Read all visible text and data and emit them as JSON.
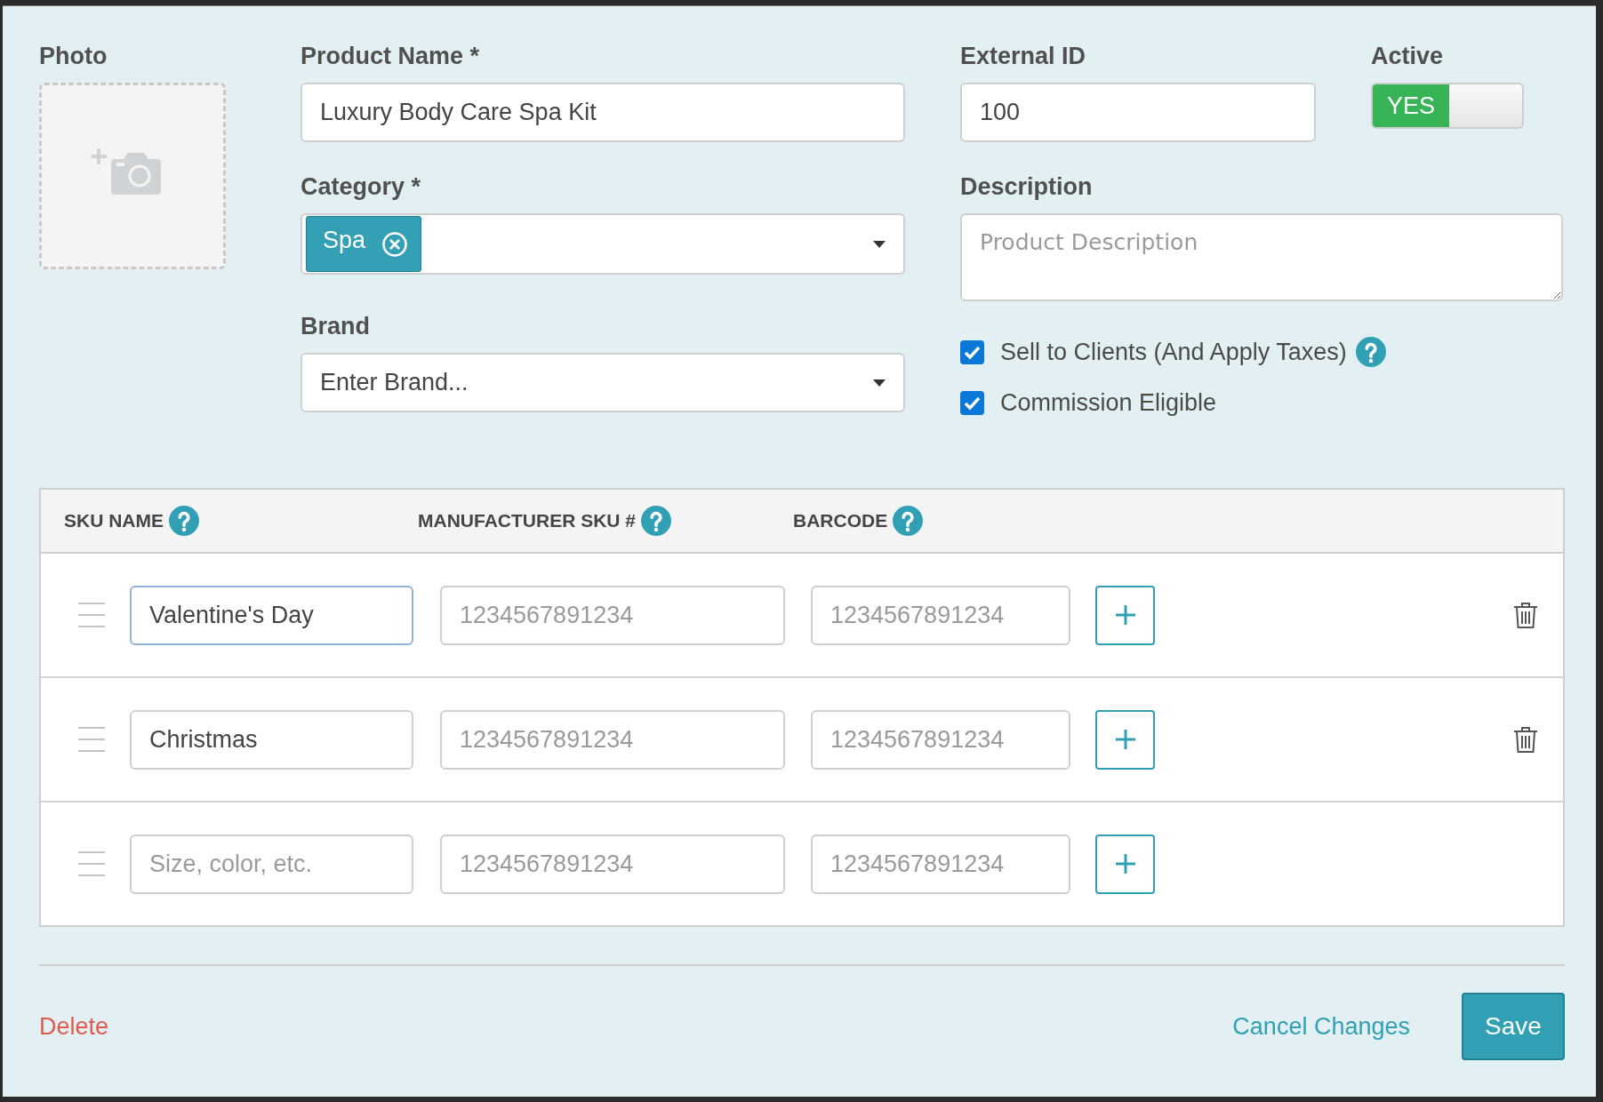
{
  "photo": {
    "label": "Photo"
  },
  "product_name": {
    "label": "Product Name *",
    "value": "Luxury Body Care Spa Kit"
  },
  "external_id": {
    "label": "External ID",
    "value": "100"
  },
  "active": {
    "label": "Active",
    "on": true,
    "on_label": "YES"
  },
  "category": {
    "label": "Category *",
    "tags": [
      {
        "label": "Spa"
      }
    ]
  },
  "description": {
    "label": "Description",
    "placeholder": "Product Description"
  },
  "brand": {
    "label": "Brand",
    "placeholder": "Enter Brand..."
  },
  "options": [
    {
      "label": "Sell to Clients (And Apply Taxes)",
      "checked": true,
      "help": true
    },
    {
      "label": "Commission Eligible",
      "checked": true,
      "help": false
    }
  ],
  "sku_table": {
    "columns": [
      {
        "label": "SKU NAME",
        "help": true
      },
      {
        "label": "MANUFACTURER SKU #",
        "help": true
      },
      {
        "label": "BARCODE",
        "help": true
      }
    ],
    "rows": [
      {
        "sku_name": {
          "value": "Valentine's Day",
          "focused": true
        },
        "manufacturer_sku": {
          "placeholder": "1234567891234"
        },
        "barcode": {
          "placeholder": "1234567891234"
        },
        "deletable": true
      },
      {
        "sku_name": {
          "value": "Christmas",
          "focused": false
        },
        "manufacturer_sku": {
          "placeholder": "1234567891234"
        },
        "barcode": {
          "placeholder": "1234567891234"
        },
        "deletable": true
      },
      {
        "sku_name": {
          "placeholder": "Size, color, etc.",
          "focused": false
        },
        "manufacturer_sku": {
          "placeholder": "1234567891234"
        },
        "barcode": {
          "placeholder": "1234567891234"
        },
        "deletable": false
      }
    ]
  },
  "footer": {
    "delete": "Delete",
    "cancel": "Cancel Changes",
    "save": "Save"
  }
}
